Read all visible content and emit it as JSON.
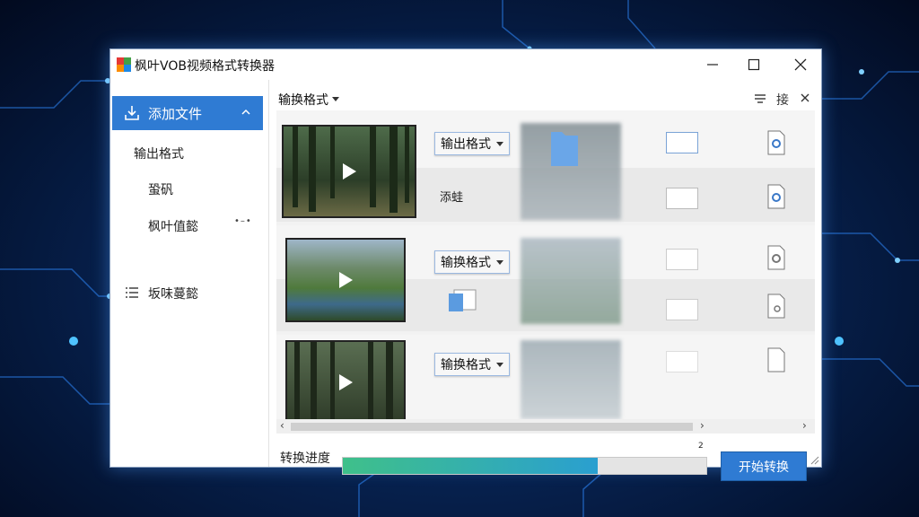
{
  "window": {
    "title": "枫叶VOB视频格式转换器"
  },
  "sidebar": {
    "add_files": "添加文件",
    "items": [
      {
        "label": "输出格式"
      },
      {
        "label": "蛩矾"
      },
      {
        "label": "枫叶值懿"
      },
      {
        "label": "坂味蔓懿"
      }
    ]
  },
  "toolbar": {
    "format_label": "输换格式",
    "right_icon_char": "接"
  },
  "rows": [
    {
      "format_button": "输出格式",
      "side_label": "添蛙"
    },
    {
      "format_button": "输换格式"
    },
    {
      "format_button": "输换格式"
    }
  ],
  "progress": {
    "label": "转换进度",
    "value_text": "2",
    "fraction": 0.7
  },
  "actions": {
    "start": "开始转换"
  },
  "colors": {
    "accent": "#2f7bd3",
    "progress_start": "#3fc08a",
    "progress_end": "#2a9fd0"
  }
}
